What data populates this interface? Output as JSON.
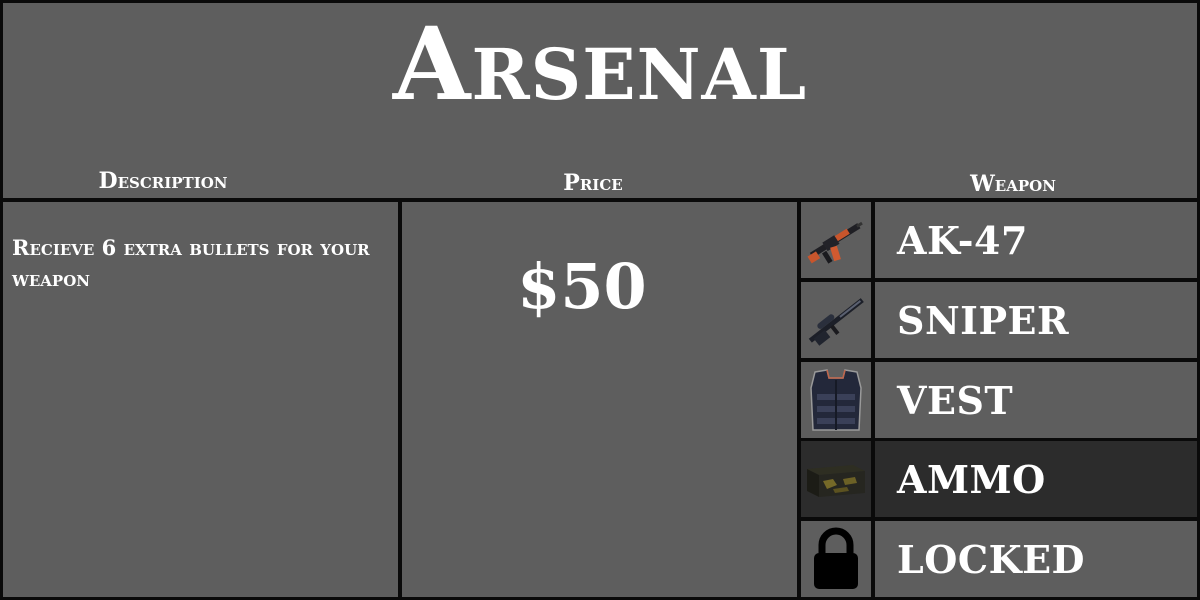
{
  "title": "Arsenal",
  "columns": {
    "description": "Description",
    "price": "Price",
    "weapon": "Weapon"
  },
  "selected": {
    "description": "Recieve 6 extra bullets for your weapon",
    "price": "$50"
  },
  "weapons": [
    {
      "label": "AK-47",
      "icon": "rifle-icon"
    },
    {
      "label": "SNIPER",
      "icon": "sniper-rifle-icon"
    },
    {
      "label": "VEST",
      "icon": "vest-icon"
    },
    {
      "label": "AMMO",
      "icon": "ammo-box-icon",
      "selected": true
    },
    {
      "label": "LOCKED",
      "icon": "lock-icon"
    }
  ],
  "colors": {
    "panel": "#5e5e5e",
    "selected_row": "#2c2c2c",
    "border": "#0a0a0a",
    "text": "#ffffff"
  }
}
